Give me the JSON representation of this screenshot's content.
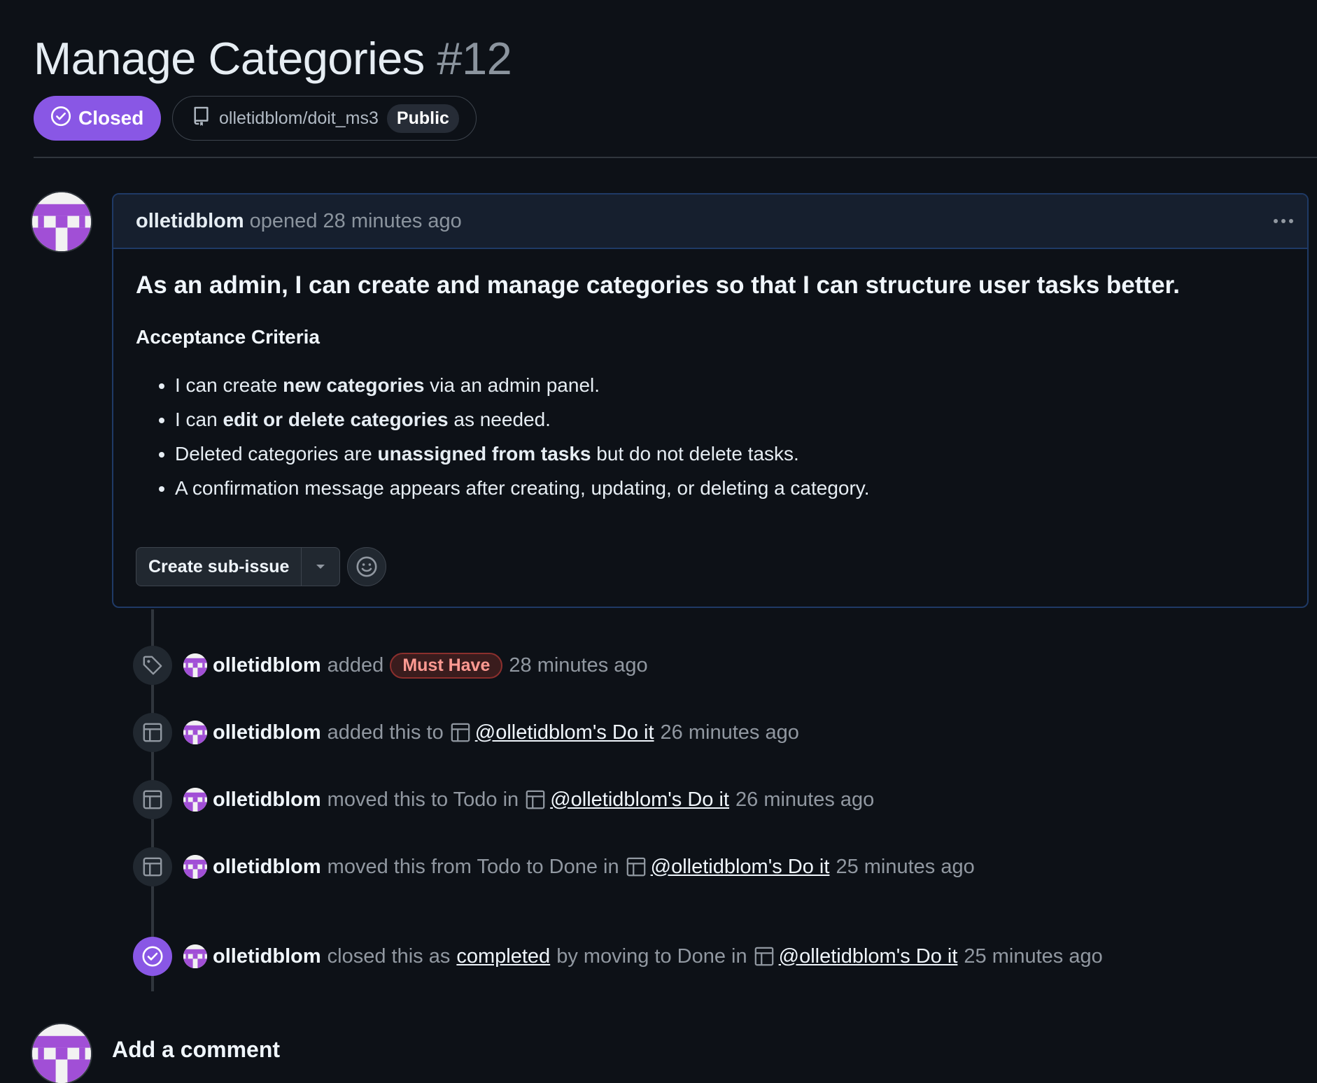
{
  "issue": {
    "title": "Manage Categories",
    "number": "#12",
    "state": "Closed",
    "state_color": "#8957e5",
    "repo": "olletidblom/doit_ms3",
    "visibility": "Public"
  },
  "comment": {
    "author": "olletidblom",
    "meta": "opened 28 minutes ago",
    "heading": "As an admin, I can create and manage categories so that I can structure user tasks better.",
    "subheading": "Acceptance Criteria",
    "criteria": [
      {
        "pre": "I can create ",
        "bold": "new categories",
        "post": " via an admin panel."
      },
      {
        "pre": "I can ",
        "bold": "edit or delete categories",
        "post": " as needed."
      },
      {
        "pre": "Deleted categories are ",
        "bold": "unassigned from tasks",
        "post": " but do not delete tasks."
      },
      {
        "pre": "A confirmation message appears after creating, updating, or deleting a category.",
        "bold": "",
        "post": ""
      }
    ],
    "create_subissue_label": "Create sub-issue"
  },
  "timeline": [
    {
      "icon": "tag-icon",
      "actor": "olletidblom",
      "action": "added",
      "label": "Must Have",
      "time": "28 minutes ago"
    },
    {
      "icon": "project-icon",
      "actor": "olletidblom",
      "action": "added this to",
      "project": "@olletidblom's Do it",
      "time": "26 minutes ago"
    },
    {
      "icon": "project-icon",
      "actor": "olletidblom",
      "action": "moved this to Todo in",
      "project": "@olletidblom's Do it",
      "time": "26 minutes ago"
    },
    {
      "icon": "project-icon",
      "actor": "olletidblom",
      "action": "moved this from Todo to Done in",
      "project": "@olletidblom's Do it",
      "time": "25 minutes ago"
    },
    {
      "icon": "check-circle-icon",
      "actor": "olletidblom",
      "action": "closed this as",
      "completed": "completed",
      "action2": "by moving to Done in",
      "project": "@olletidblom's Do it",
      "time": "25 minutes ago"
    }
  ],
  "add_comment": {
    "title": "Add a comment"
  },
  "colors": {
    "background": "#0d1117",
    "accent_purple": "#8957e5",
    "label_red": "#ff9a92"
  }
}
